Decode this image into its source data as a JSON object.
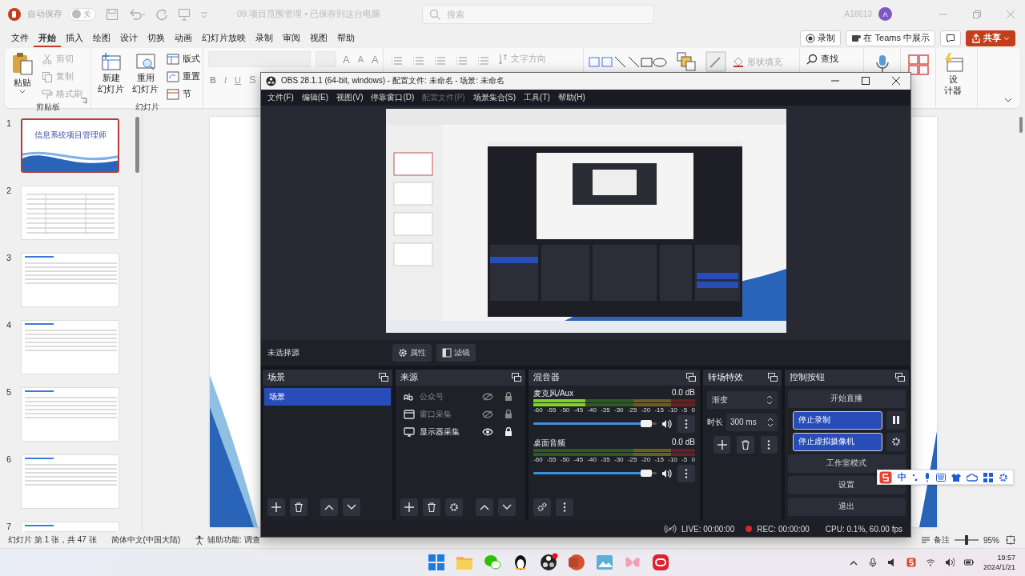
{
  "ppt": {
    "titlebar": {
      "autosave_label": "自动保存",
      "autosave_on": false,
      "autosave_state": "关",
      "document_title": "09.项目范围管理 • 已保存到这台电脑",
      "search_placeholder": "搜索",
      "user": "A18613",
      "avatar": "A"
    },
    "tabs": [
      {
        "label": "文件",
        "selected": false
      },
      {
        "label": "开始",
        "selected": true
      },
      {
        "label": "插入",
        "selected": false
      },
      {
        "label": "绘图",
        "selected": false
      },
      {
        "label": "设计",
        "selected": false
      },
      {
        "label": "切换",
        "selected": false
      },
      {
        "label": "动画",
        "selected": false
      },
      {
        "label": "幻灯片放映",
        "selected": false
      },
      {
        "label": "录制",
        "selected": false
      },
      {
        "label": "审阅",
        "selected": false
      },
      {
        "label": "视图",
        "selected": false
      },
      {
        "label": "帮助",
        "selected": false
      }
    ],
    "actions": [
      {
        "kind": "record",
        "label": "录制"
      },
      {
        "kind": "teams",
        "label": "在 Teams 中展示"
      },
      {
        "kind": "comment"
      },
      {
        "kind": "share",
        "label": "共享"
      }
    ],
    "ribbon": {
      "clipboard": {
        "paste": "粘贴",
        "cut": "剪切",
        "copy": "复制",
        "format_painter": "格式刷",
        "group": "剪贴板"
      },
      "slides": {
        "new_slide": [
          "新建",
          "幻灯片"
        ],
        "reuse_slide": [
          "重用",
          "幻灯片"
        ],
        "layout": "版式",
        "reset": "重置",
        "section": "节",
        "group": "幻灯片"
      },
      "font": {
        "grow": "A",
        "shrink": "A",
        "clear": "A",
        "bold": "B",
        "italic": "I",
        "underline": "U",
        "strike": "S"
      },
      "paragraph": {
        "text_direction": "文字方向"
      },
      "drawing": {
        "shape_fill": "形状填充"
      },
      "editing": {
        "find": "查找"
      },
      "designer": [
        "设",
        "计器"
      ]
    },
    "thumbnails": [
      {
        "number": "1",
        "selected": true,
        "kind": "title",
        "title": "信息系统项目管理师"
      },
      {
        "number": "2",
        "selected": false,
        "kind": "table"
      },
      {
        "number": "3",
        "selected": false,
        "kind": "text"
      },
      {
        "number": "4",
        "selected": false,
        "kind": "text"
      },
      {
        "number": "5",
        "selected": false,
        "kind": "text"
      },
      {
        "number": "6",
        "selected": false,
        "kind": "text"
      },
      {
        "number": "7",
        "selected": false,
        "kind": "text"
      }
    ],
    "status_bar": {
      "slide_info": "幻灯片 第 1 张，共 47 张",
      "language": "简体中文(中国大陆)",
      "accessibility": "辅助功能: 调查",
      "notes": "备注",
      "zoom": "95%",
      "zoom_slider": {
        "level": 0.5
      }
    }
  },
  "obs": {
    "title": "OBS 28.1.1 (64-bit, windows) - 配置文件: 未命名 - 场景: 未命名",
    "menu": [
      {
        "label": "文件(F)",
        "disabled": false
      },
      {
        "label": "编辑(E)",
        "disabled": false
      },
      {
        "label": "视图(V)",
        "disabled": false
      },
      {
        "label": "停靠窗口(D)",
        "disabled": false
      },
      {
        "label": "配置文件(P)",
        "disabled": true
      },
      {
        "label": "场景集合(S)",
        "disabled": false
      },
      {
        "label": "工具(T)",
        "disabled": false
      },
      {
        "label": "帮助(H)",
        "disabled": false
      }
    ],
    "source_toolbar": {
      "status": "未选择源",
      "buttons": [
        {
          "kind": "properties",
          "label": "属性"
        },
        {
          "kind": "filters",
          "label": "滤镜"
        }
      ]
    },
    "scenes": {
      "title": "场景",
      "items": [
        {
          "label": "场景",
          "selected": true
        }
      ]
    },
    "sources": {
      "title": "来源",
      "items": [
        {
          "kind": "text",
          "label": "公众号",
          "visible": false
        },
        {
          "kind": "window",
          "label": "窗口采集",
          "visible": false
        },
        {
          "kind": "display",
          "label": "显示器采集",
          "visible": true
        }
      ]
    },
    "mixer": {
      "title": "混音器",
      "channels": [
        {
          "name": "麦克风/Aux",
          "reading": "0.0 dB",
          "scale": [
            "-60",
            "-55",
            "-50",
            "-45",
            "-40",
            "-35",
            "-30",
            "-25",
            "-20",
            "-15",
            "-10",
            "-5",
            "0"
          ],
          "meter": {
            "level": 0.32
          },
          "volume": {
            "level": 0.96
          }
        },
        {
          "name": "桌面音频",
          "reading": "0.0 dB",
          "scale": [
            "-60",
            "-55",
            "-50",
            "-45",
            "-40",
            "-35",
            "-30",
            "-25",
            "-20",
            "-15",
            "-10",
            "-5",
            "0"
          ],
          "meter": {
            "level": 0.0
          },
          "volume": {
            "level": 0.96
          }
        }
      ]
    },
    "transitions": {
      "title": "转场特效",
      "type": "渐变",
      "duration_label": "时长",
      "duration": "300 ms"
    },
    "controls": {
      "title": "控制按钮",
      "buttons": [
        {
          "kind": "stream",
          "label": "开始直播",
          "active": false
        },
        {
          "kind": "record",
          "label": "停止录制",
          "active": true
        },
        {
          "kind": "virtualcam",
          "label": "停止虚拟摄像机",
          "active": true
        },
        {
          "kind": "studio",
          "label": "工作室模式",
          "active": false
        },
        {
          "kind": "settings",
          "label": "设置",
          "active": false
        },
        {
          "kind": "exit",
          "label": "退出",
          "active": false
        }
      ]
    },
    "status": {
      "live": "LIVE: 00:00:00",
      "rec": "REC: 00:00:00",
      "cpu": "CPU: 0.1%, 60.00 fps"
    }
  },
  "ime": {
    "label": "中"
  },
  "taskbar": {
    "apps": [
      {
        "kind": "start"
      },
      {
        "kind": "folder"
      },
      {
        "kind": "chat"
      },
      {
        "kind": "penguin"
      },
      {
        "kind": "obs"
      },
      {
        "kind": "slides"
      },
      {
        "kind": "photo"
      },
      {
        "kind": "butterfly"
      },
      {
        "kind": "rounded"
      }
    ],
    "tray": [
      {
        "kind": "chevron"
      },
      {
        "kind": "mic"
      },
      {
        "kind": "speaker"
      },
      {
        "kind": "ime"
      },
      {
        "kind": "wifi"
      },
      {
        "kind": "volume"
      },
      {
        "kind": "battery"
      }
    ],
    "time": "19:57",
    "date": "2024/1/21"
  }
}
